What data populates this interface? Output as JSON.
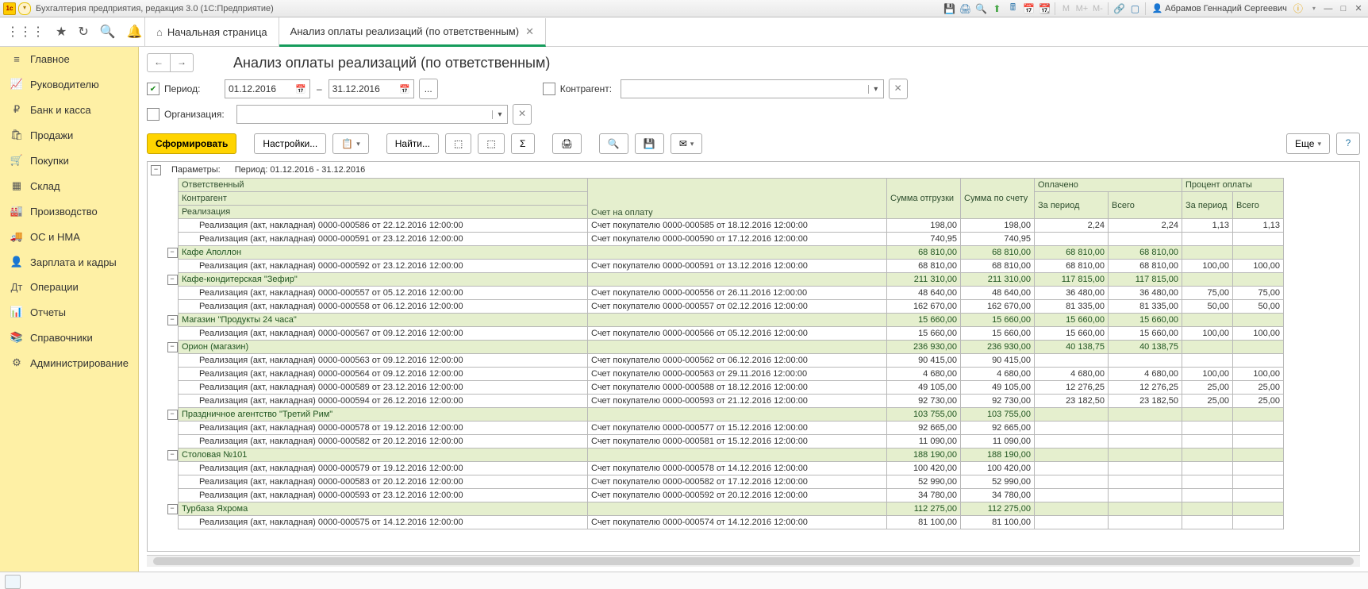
{
  "app": {
    "title": "Бухгалтерия предприятия, редакция 3.0  (1С:Предприятие)",
    "user": "Абрамов Геннадий Сергеевич",
    "mem_buttons": [
      "M",
      "M+",
      "M-"
    ]
  },
  "top_tools": {
    "apps": "⋮⋮⋮",
    "star": "★",
    "history": "↻",
    "search": "🔍",
    "bell": "🔔"
  },
  "tabs": {
    "home": "Начальная страница",
    "active": "Анализ оплаты реализаций (по ответственным)"
  },
  "sidebar": [
    {
      "icon": "≡",
      "label": "Главное"
    },
    {
      "icon": "📈",
      "label": "Руководителю"
    },
    {
      "icon": "₽",
      "label": "Банк и касса"
    },
    {
      "icon": "🛍",
      "label": "Продажи"
    },
    {
      "icon": "🛒",
      "label": "Покупки"
    },
    {
      "icon": "▦",
      "label": "Склад"
    },
    {
      "icon": "🏭",
      "label": "Производство"
    },
    {
      "icon": "🚚",
      "label": "ОС и НМА"
    },
    {
      "icon": "👤",
      "label": "Зарплата и кадры"
    },
    {
      "icon": "Дт",
      "label": "Операции"
    },
    {
      "icon": "📊",
      "label": "Отчеты"
    },
    {
      "icon": "📚",
      "label": "Справочники"
    },
    {
      "icon": "⚙",
      "label": "Администрирование"
    }
  ],
  "page": {
    "title": "Анализ оплаты реализаций (по ответственным)"
  },
  "filters": {
    "period_label": "Период:",
    "date_from": "01.12.2016",
    "date_to": "31.12.2016",
    "ellipsis": "...",
    "contr_label": "Контрагент:",
    "org_label": "Организация:"
  },
  "toolbar": {
    "form": "Сформировать",
    "settings": "Настройки...",
    "find": "Найти...",
    "more": "Еще"
  },
  "report": {
    "param_lbl": "Параметры:",
    "param_val": "Период: 01.12.2016 - 31.12.2016",
    "headers": {
      "resp": "Ответственный",
      "contr": "Контрагент",
      "real": "Реализация",
      "invoice": "Счет на оплату",
      "ship": "Сумма отгрузки",
      "bill": "Сумма по счету",
      "paid": "Оплачено",
      "paid_period": "За период",
      "paid_total": "Всего",
      "pct": "Процент оплаты",
      "pct_period": "За период",
      "pct_total": "Всего"
    },
    "rows": [
      {
        "type": "detail",
        "desc": "Реализация (акт, накладная) 0000-000586 от 22.12.2016 12:00:00",
        "inv": "Счет покупателю 0000-000585 от 18.12.2016 12:00:00",
        "ship": "198,00",
        "bill": "198,00",
        "pp": "2,24",
        "pt": "2,24",
        "pctp": "1,13",
        "pctt": "1,13"
      },
      {
        "type": "detail",
        "desc": "Реализация (акт, накладная) 0000-000591 от 23.12.2016 12:00:00",
        "inv": "Счет покупателю 0000-000590 от 17.12.2016 12:00:00",
        "ship": "740,95",
        "bill": "740,95",
        "pp": "",
        "pt": "",
        "pctp": "",
        "pctt": ""
      },
      {
        "type": "group",
        "desc": "Кафе Аполлон",
        "inv": "",
        "ship": "68 810,00",
        "bill": "68 810,00",
        "pp": "68 810,00",
        "pt": "68 810,00",
        "pctp": "",
        "pctt": ""
      },
      {
        "type": "detail",
        "desc": "Реализация (акт, накладная) 0000-000592 от 23.12.2016 12:00:00",
        "inv": "Счет покупателю 0000-000591 от 13.12.2016 12:00:00",
        "ship": "68 810,00",
        "bill": "68 810,00",
        "pp": "68 810,00",
        "pt": "68 810,00",
        "pctp": "100,00",
        "pctt": "100,00"
      },
      {
        "type": "group",
        "desc": "Кафе-кондитерская \"Зефир\"",
        "inv": "",
        "ship": "211 310,00",
        "bill": "211 310,00",
        "pp": "117 815,00",
        "pt": "117 815,00",
        "pctp": "",
        "pctt": ""
      },
      {
        "type": "detail",
        "desc": "Реализация (акт, накладная) 0000-000557 от 05.12.2016 12:00:00",
        "inv": "Счет покупателю 0000-000556 от 26.11.2016 12:00:00",
        "ship": "48 640,00",
        "bill": "48 640,00",
        "pp": "36 480,00",
        "pt": "36 480,00",
        "pctp": "75,00",
        "pctt": "75,00"
      },
      {
        "type": "detail",
        "desc": "Реализация (акт, накладная) 0000-000558 от 06.12.2016 12:00:00",
        "inv": "Счет покупателю 0000-000557 от 02.12.2016 12:00:00",
        "ship": "162 670,00",
        "bill": "162 670,00",
        "pp": "81 335,00",
        "pt": "81 335,00",
        "pctp": "50,00",
        "pctt": "50,00"
      },
      {
        "type": "group",
        "desc": "Магазин \"Продукты 24 часа\"",
        "inv": "",
        "ship": "15 660,00",
        "bill": "15 660,00",
        "pp": "15 660,00",
        "pt": "15 660,00",
        "pctp": "",
        "pctt": ""
      },
      {
        "type": "detail",
        "desc": "Реализация (акт, накладная) 0000-000567 от 09.12.2016 12:00:00",
        "inv": "Счет покупателю 0000-000566 от 05.12.2016 12:00:00",
        "ship": "15 660,00",
        "bill": "15 660,00",
        "pp": "15 660,00",
        "pt": "15 660,00",
        "pctp": "100,00",
        "pctt": "100,00"
      },
      {
        "type": "group",
        "desc": "Орион (магазин)",
        "inv": "",
        "ship": "236 930,00",
        "bill": "236 930,00",
        "pp": "40 138,75",
        "pt": "40 138,75",
        "pctp": "",
        "pctt": ""
      },
      {
        "type": "detail",
        "desc": "Реализация (акт, накладная) 0000-000563 от 09.12.2016 12:00:00",
        "inv": "Счет покупателю 0000-000562 от 06.12.2016 12:00:00",
        "ship": "90 415,00",
        "bill": "90 415,00",
        "pp": "",
        "pt": "",
        "pctp": "",
        "pctt": ""
      },
      {
        "type": "detail",
        "desc": "Реализация (акт, накладная) 0000-000564 от 09.12.2016 12:00:00",
        "inv": "Счет покупателю 0000-000563 от 29.11.2016 12:00:00",
        "ship": "4 680,00",
        "bill": "4 680,00",
        "pp": "4 680,00",
        "pt": "4 680,00",
        "pctp": "100,00",
        "pctt": "100,00"
      },
      {
        "type": "detail",
        "desc": "Реализация (акт, накладная) 0000-000589 от 23.12.2016 12:00:00",
        "inv": "Счет покупателю 0000-000588 от 18.12.2016 12:00:00",
        "ship": "49 105,00",
        "bill": "49 105,00",
        "pp": "12 276,25",
        "pt": "12 276,25",
        "pctp": "25,00",
        "pctt": "25,00"
      },
      {
        "type": "detail",
        "desc": "Реализация (акт, накладная) 0000-000594 от 26.12.2016 12:00:00",
        "inv": "Счет покупателю 0000-000593 от 21.12.2016 12:00:00",
        "ship": "92 730,00",
        "bill": "92 730,00",
        "pp": "23 182,50",
        "pt": "23 182,50",
        "pctp": "25,00",
        "pctt": "25,00"
      },
      {
        "type": "group",
        "desc": "Праздничное агентство \"Третий Рим\"",
        "inv": "",
        "ship": "103 755,00",
        "bill": "103 755,00",
        "pp": "",
        "pt": "",
        "pctp": "",
        "pctt": ""
      },
      {
        "type": "detail",
        "desc": "Реализация (акт, накладная) 0000-000578 от 19.12.2016 12:00:00",
        "inv": "Счет покупателю 0000-000577 от 15.12.2016 12:00:00",
        "ship": "92 665,00",
        "bill": "92 665,00",
        "pp": "",
        "pt": "",
        "pctp": "",
        "pctt": ""
      },
      {
        "type": "detail",
        "desc": "Реализация (акт, накладная) 0000-000582 от 20.12.2016 12:00:00",
        "inv": "Счет покупателю 0000-000581 от 15.12.2016 12:00:00",
        "ship": "11 090,00",
        "bill": "11 090,00",
        "pp": "",
        "pt": "",
        "pctp": "",
        "pctt": ""
      },
      {
        "type": "group",
        "desc": "Столовая №101",
        "inv": "",
        "ship": "188 190,00",
        "bill": "188 190,00",
        "pp": "",
        "pt": "",
        "pctp": "",
        "pctt": ""
      },
      {
        "type": "detail",
        "desc": "Реализация (акт, накладная) 0000-000579 от 19.12.2016 12:00:00",
        "inv": "Счет покупателю 0000-000578 от 14.12.2016 12:00:00",
        "ship": "100 420,00",
        "bill": "100 420,00",
        "pp": "",
        "pt": "",
        "pctp": "",
        "pctt": ""
      },
      {
        "type": "detail",
        "desc": "Реализация (акт, накладная) 0000-000583 от 20.12.2016 12:00:00",
        "inv": "Счет покупателю 0000-000582 от 17.12.2016 12:00:00",
        "ship": "52 990,00",
        "bill": "52 990,00",
        "pp": "",
        "pt": "",
        "pctp": "",
        "pctt": ""
      },
      {
        "type": "detail",
        "desc": "Реализация (акт, накладная) 0000-000593 от 23.12.2016 12:00:00",
        "inv": "Счет покупателю 0000-000592 от 20.12.2016 12:00:00",
        "ship": "34 780,00",
        "bill": "34 780,00",
        "pp": "",
        "pt": "",
        "pctp": "",
        "pctt": ""
      },
      {
        "type": "group",
        "desc": "Турбаза Яхрома",
        "inv": "",
        "ship": "112 275,00",
        "bill": "112 275,00",
        "pp": "",
        "pt": "",
        "pctp": "",
        "pctt": ""
      },
      {
        "type": "detail",
        "desc": "Реализация (акт, накладная) 0000-000575 от 14.12.2016 12:00:00",
        "inv": "Счет покупателю 0000-000574 от 14.12.2016 12:00:00",
        "ship": "81 100,00",
        "bill": "81 100,00",
        "pp": "",
        "pt": "",
        "pctp": "",
        "pctt": ""
      }
    ]
  }
}
